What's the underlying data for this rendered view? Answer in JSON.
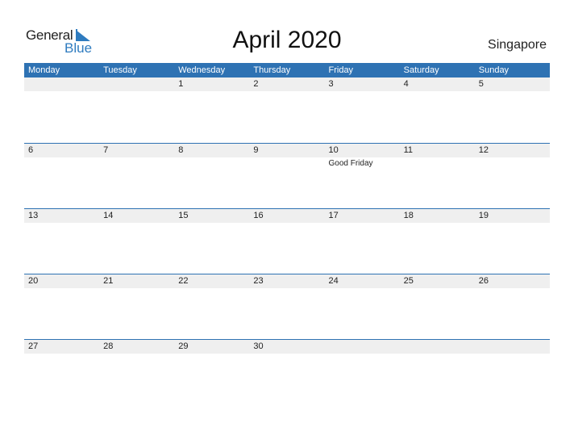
{
  "logo": {
    "line1": "General",
    "line2": "Blue"
  },
  "title": "April 2020",
  "country": "Singapore",
  "colors": {
    "accent": "#2e72b3",
    "row_bg": "#efefef"
  },
  "weekdays": [
    "Monday",
    "Tuesday",
    "Wednesday",
    "Thursday",
    "Friday",
    "Saturday",
    "Sunday"
  ],
  "weeks": [
    {
      "days": [
        "",
        "",
        "1",
        "2",
        "3",
        "4",
        "5"
      ],
      "events": [
        "",
        "",
        "",
        "",
        "",
        "",
        ""
      ]
    },
    {
      "days": [
        "6",
        "7",
        "8",
        "9",
        "10",
        "11",
        "12"
      ],
      "events": [
        "",
        "",
        "",
        "",
        "Good Friday",
        "",
        ""
      ]
    },
    {
      "days": [
        "13",
        "14",
        "15",
        "16",
        "17",
        "18",
        "19"
      ],
      "events": [
        "",
        "",
        "",
        "",
        "",
        "",
        ""
      ]
    },
    {
      "days": [
        "20",
        "21",
        "22",
        "23",
        "24",
        "25",
        "26"
      ],
      "events": [
        "",
        "",
        "",
        "",
        "",
        "",
        ""
      ]
    },
    {
      "days": [
        "27",
        "28",
        "29",
        "30",
        "",
        "",
        ""
      ],
      "events": [
        "",
        "",
        "",
        "",
        "",
        "",
        ""
      ]
    }
  ]
}
